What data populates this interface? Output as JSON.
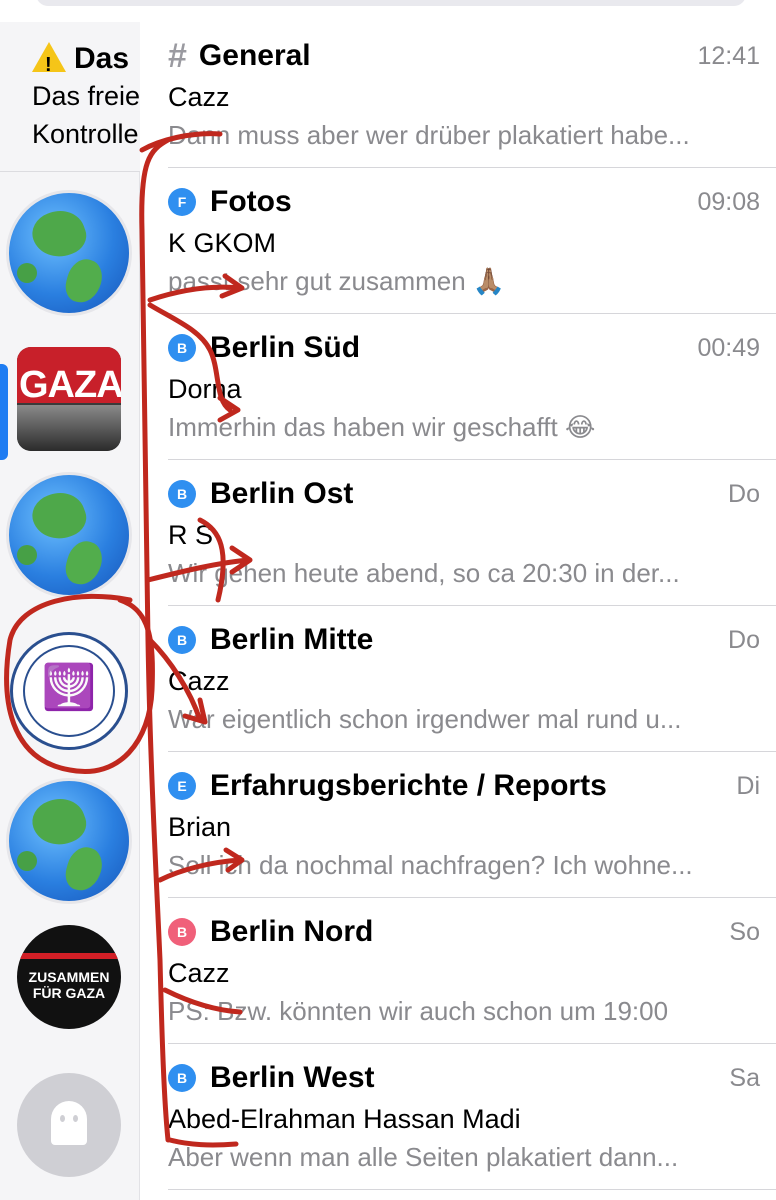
{
  "rail": {
    "header": {
      "title": "Das",
      "line1": "Das freie",
      "line2": "Kontrolle"
    },
    "items": [
      {
        "kind": "globe",
        "icon": "globe-icon"
      },
      {
        "kind": "gaza",
        "label": "GAZA",
        "selected": true
      },
      {
        "kind": "globe",
        "icon": "globe-icon"
      },
      {
        "kind": "mossad",
        "icon": "menorah-icon"
      },
      {
        "kind": "globe",
        "icon": "globe-icon"
      },
      {
        "kind": "zusammen",
        "label": "ZUSAMMEN FÜR GAZA"
      },
      {
        "kind": "ghost",
        "icon": "ghost-icon"
      }
    ]
  },
  "chats": [
    {
      "icon": "#",
      "icon_color": "",
      "title": "General",
      "time": "12:41",
      "sender": "Cazz",
      "preview": "Dann muss aber wer drüber plakatiert habe..."
    },
    {
      "icon": "F",
      "icon_color": "#2f8ff0",
      "title": "Fotos",
      "time": "09:08",
      "sender": "K GKOM",
      "preview": "passt sehr gut zusammen 🙏🏽"
    },
    {
      "icon": "B",
      "icon_color": "#2f8ff0",
      "title": "Berlin Süd",
      "time": "00:49",
      "sender": "Dorna",
      "preview": "Immerhin das haben wir geschafft 😂"
    },
    {
      "icon": "B",
      "icon_color": "#2f8ff0",
      "title": "Berlin Ost",
      "time": "Do",
      "sender": "R S",
      "preview": "Wir gehen heute abend, so ca 20:30 in der..."
    },
    {
      "icon": "B",
      "icon_color": "#2f8ff0",
      "title": "Berlin Mitte",
      "time": "Do",
      "sender": "Cazz",
      "preview": "War eigentlich schon irgendwer mal rund u..."
    },
    {
      "icon": "E",
      "icon_color": "#2f8ff0",
      "title": "Erfahrugsberichte / Reports",
      "time": "Di",
      "sender": "Brian",
      "preview": "Soll ich da nochmal nachfragen? Ich wohne..."
    },
    {
      "icon": "B",
      "icon_color": "#f0607a",
      "title": "Berlin Nord",
      "time": "So",
      "sender": "Cazz",
      "preview": "PS: Bzw. könnten wir auch schon um 19:00"
    },
    {
      "icon": "B",
      "icon_color": "#2f8ff0",
      "title": "Berlin West",
      "time": "Sa",
      "sender": "Abed-Elrahman Hassan Madi",
      "preview": "Aber wenn man alle Seiten plakatiert dann..."
    }
  ],
  "annotation": {
    "color": "#c0281e"
  }
}
